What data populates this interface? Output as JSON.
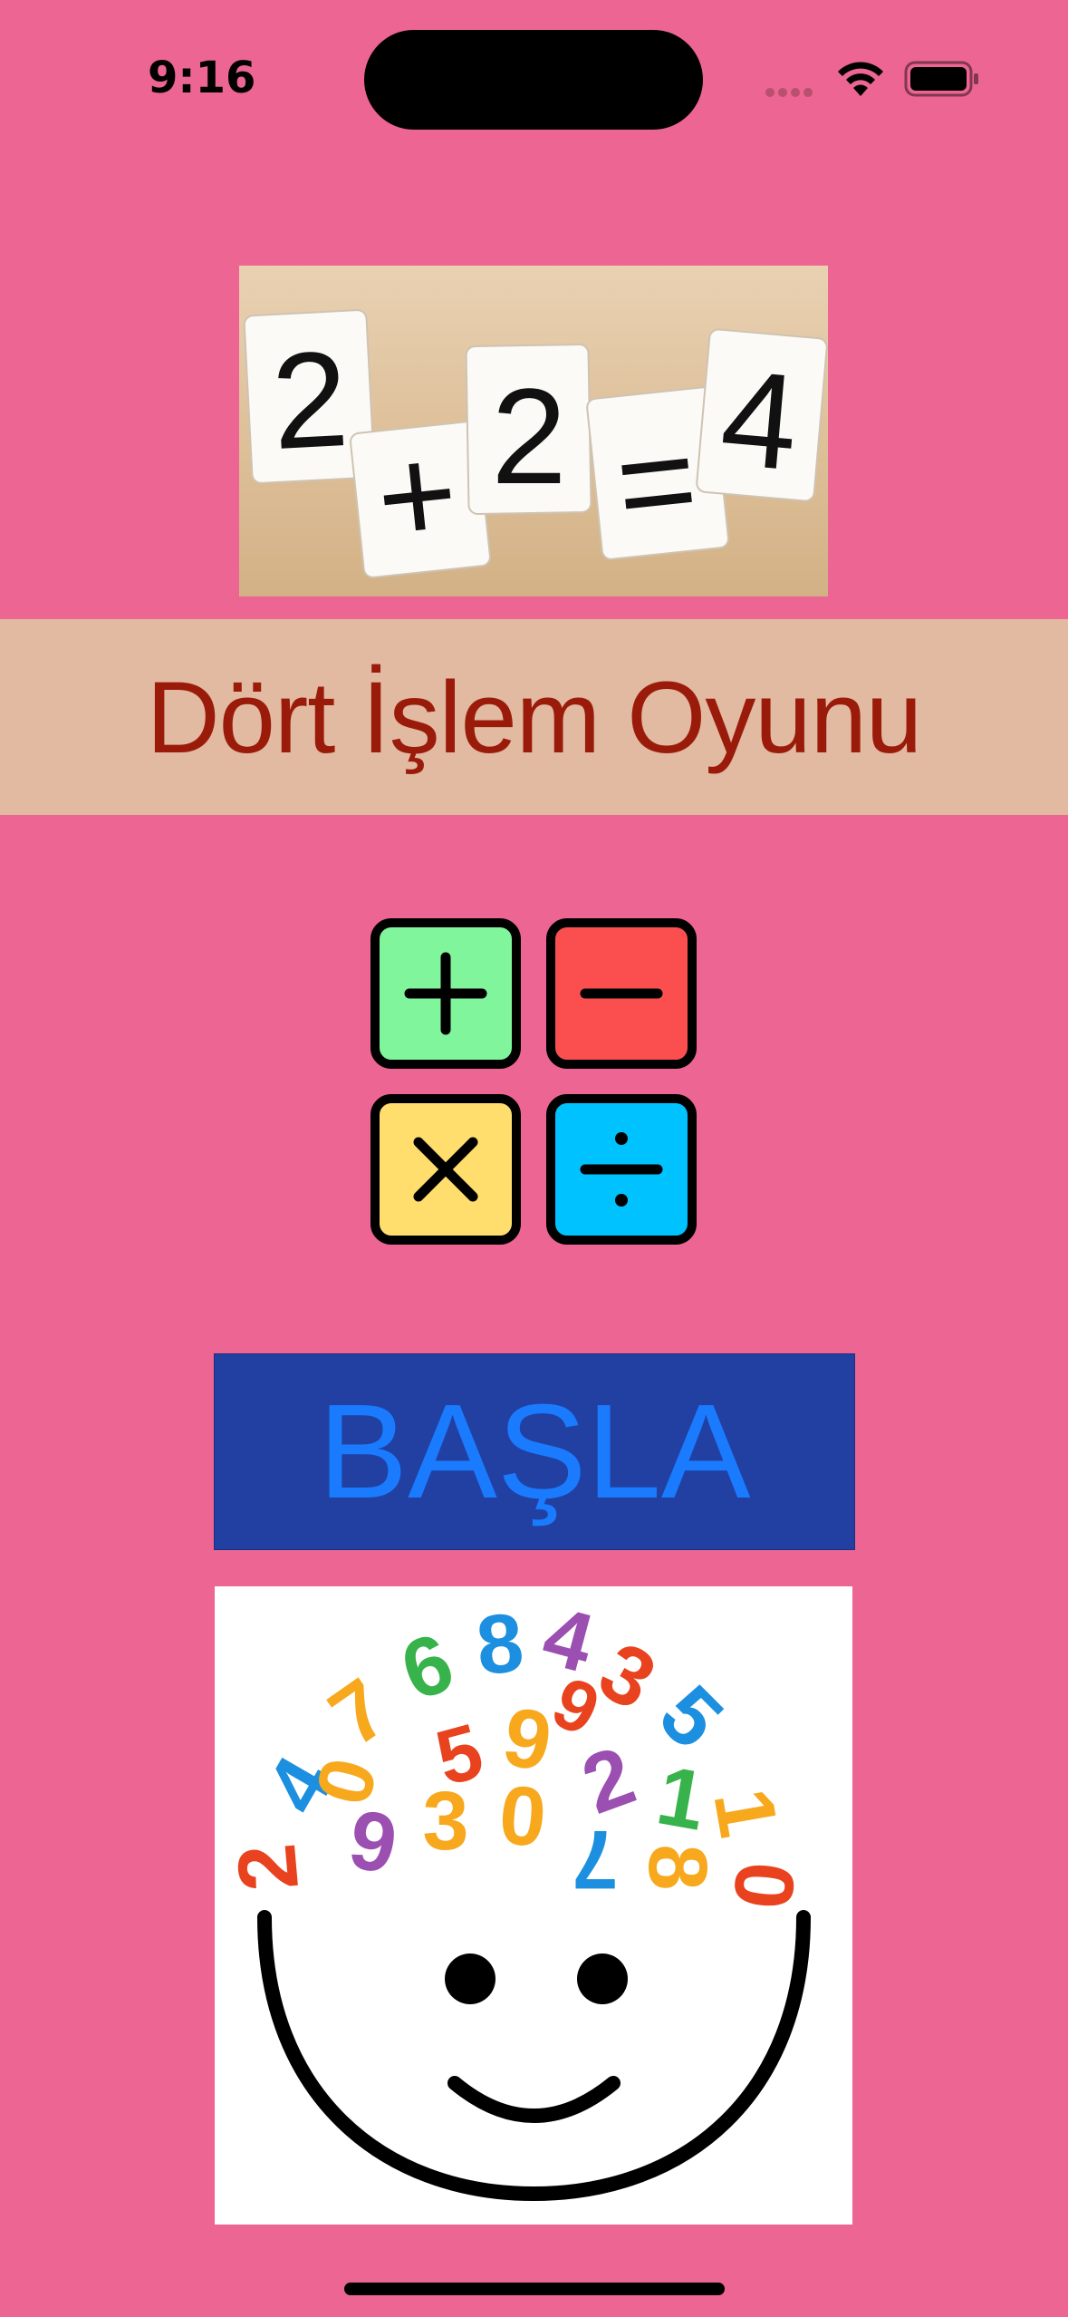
{
  "status_bar": {
    "time": "9:16",
    "icons": [
      "cellular-signal-icon",
      "wifi-icon",
      "battery-icon"
    ]
  },
  "header_image": {
    "icon": "math-cards-image",
    "cards": [
      "2",
      "+",
      "2",
      "=",
      "4"
    ]
  },
  "title": "Dört İşlem Oyunu",
  "operations": [
    {
      "symbol": "+",
      "color": "#80F59B"
    },
    {
      "symbol": "−",
      "color": "#FB4F4F"
    },
    {
      "symbol": "×",
      "color": "#FFDE6E"
    },
    {
      "symbol": "÷",
      "color": "#00C2FF"
    }
  ],
  "start_button": {
    "label": "BAŞLA"
  },
  "footer_image": {
    "icon": "smiling-head-numbers-image",
    "digits": [
      "2",
      "4",
      "7",
      "6",
      "8",
      "4",
      "3",
      "5",
      "9",
      "1",
      "0",
      "2",
      "3",
      "0",
      "6",
      "1",
      "7",
      "8",
      "9",
      "5",
      "0"
    ]
  },
  "colors": {
    "background": "#EC6593",
    "title_band": "#E2B9A1",
    "title_text": "#9B1B0B",
    "button_bg": "#2140A2",
    "button_text": "#1A7BFF"
  }
}
